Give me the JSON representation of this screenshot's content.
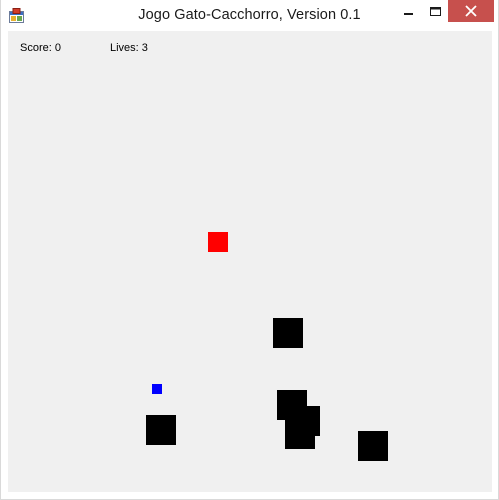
{
  "window": {
    "title": "Jogo Gato-Cacchorro, Version 0.1",
    "icons": {
      "app": "app-icon",
      "minimize": "minimize-icon",
      "maximize": "maximize-icon",
      "close": "close-icon"
    }
  },
  "hud": {
    "score_text": "Score: 0",
    "lives_text": "Lives: 3"
  },
  "game": {
    "score": 0,
    "lives": 3,
    "enemy_count": 6
  },
  "colors": {
    "client_background": "#f0f0f0",
    "close_button": "#c7504d",
    "player": "#ff0000",
    "food": "#0000ff",
    "enemy": "#000000"
  }
}
